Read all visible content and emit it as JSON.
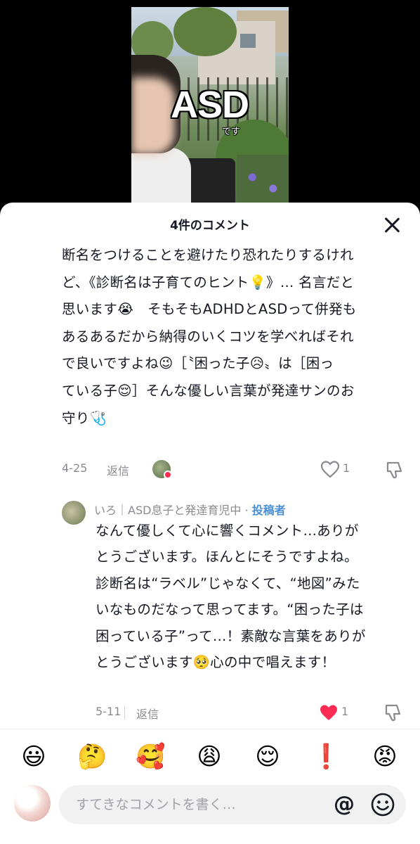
{
  "video": {
    "caption_main": "ASD",
    "caption_sub": "です"
  },
  "sheet": {
    "title": "4件のコメント"
  },
  "comments": [
    {
      "lines": [
        "断名をつけることを避けたり恐れたりするけれ",
        "ど、《診断名は子育てのヒント💡》… 名言だと",
        "思います😭　そもそもADHDとASDって併発も",
        "あるあるだから納得のいくコツを学べればそれ",
        "で良いですよね😉［〝困った子😥〟は［困っ",
        "ている子😌］そんな優しい言葉が発達サンのお",
        "守り🩺"
      ],
      "date": "4-25",
      "reply_label": "返信",
      "likes": "1"
    },
    {
      "author": "いろ｜ASD息子と発達育児中",
      "separator": " · ",
      "author_tag": "投稿者",
      "lines": [
        "なんて優しくて心に響くコメント…ありが",
        "とうございます。ほんとにそうですよね。",
        "診断名は“ラベル”じゃなくて、“地図”みた",
        "いなものだなって思ってます。“困った子は",
        "困っている子”って…！素敵な言葉をありが",
        "とうございます🥺心の中で唱えます！"
      ],
      "date": "5-11",
      "reply_label": "返信",
      "likes": "1"
    }
  ],
  "emoji_bar": [
    "😃",
    "🤔",
    "🥰",
    "😩",
    "😌",
    "❗",
    "😡"
  ],
  "input": {
    "placeholder": "すてきなコメントを書く…",
    "mention": "@"
  },
  "colors": {
    "like_active": "#fe2c55",
    "author_tag": "#4a8fd6",
    "meta_text": "#8a8b91"
  }
}
